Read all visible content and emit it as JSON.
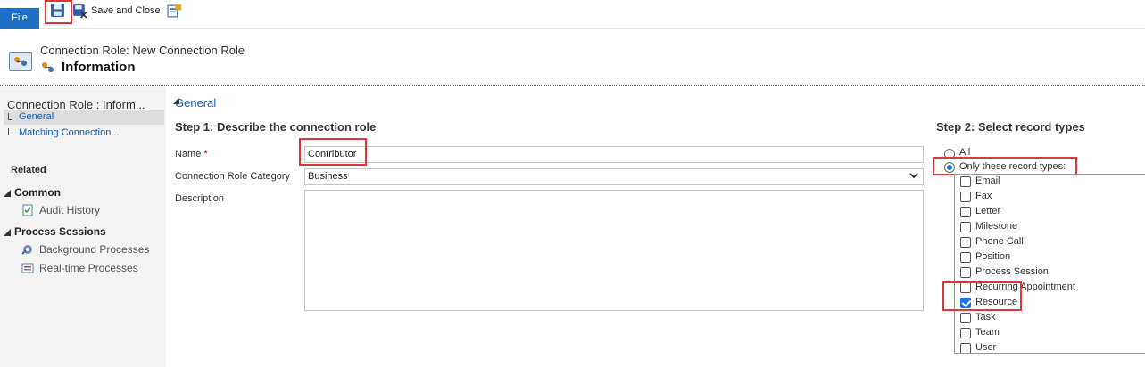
{
  "toolbar": {
    "file_label": "File",
    "save_and_close_label": "Save and Close",
    "save_icon": "save-icon",
    "save_close_icon": "save-close-icon",
    "more_icon": "form-editor-icon"
  },
  "header": {
    "entity_label": "Connection Role: New Connection Role",
    "form_title": "Information"
  },
  "nav": {
    "title": "Connection Role : Inform...",
    "general": "General",
    "matching": "Matching Connection...",
    "related": "Related",
    "common": "Common",
    "audit_history": "Audit History",
    "process_sessions": "Process Sessions",
    "background_processes": "Background Processes",
    "realtime_processes": "Real-time Processes"
  },
  "form": {
    "section": "General",
    "step1": "Step 1: Describe the connection role",
    "name_label": "Name",
    "required_mark": "*",
    "name_value": "Contributor",
    "category_label": "Connection Role Category",
    "category_value": "Business",
    "description_label": "Description",
    "description_value": ""
  },
  "step2": {
    "heading": "Step 2: Select record types",
    "option_all": "All",
    "option_only": "Only these record types:",
    "selected_option": "only",
    "record_types": [
      {
        "label": "Email",
        "checked": false
      },
      {
        "label": "Fax",
        "checked": false
      },
      {
        "label": "Letter",
        "checked": false
      },
      {
        "label": "Milestone",
        "checked": false
      },
      {
        "label": "Phone Call",
        "checked": false
      },
      {
        "label": "Position",
        "checked": false
      },
      {
        "label": "Process Session",
        "checked": false
      },
      {
        "label": "Recurring Appointment",
        "checked": false
      },
      {
        "label": "Resource",
        "checked": true
      },
      {
        "label": "Task",
        "checked": false
      },
      {
        "label": "Team",
        "checked": false
      },
      {
        "label": "User",
        "checked": false
      }
    ]
  },
  "colors": {
    "accent": "#1f6fc5",
    "highlight": "#e0353a",
    "link": "#1160b7"
  }
}
